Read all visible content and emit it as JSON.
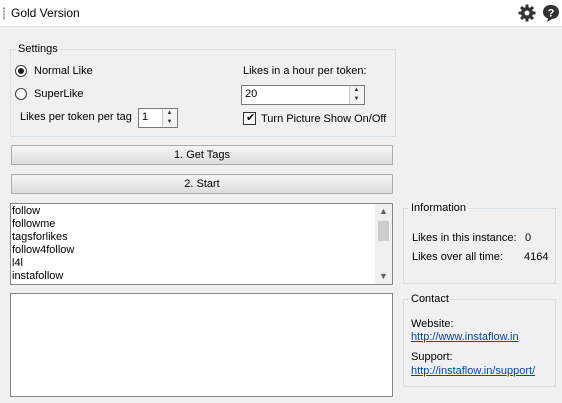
{
  "window": {
    "title": "Gold Version"
  },
  "icons": {
    "settings": "gear-icon",
    "help": "help-bubble-icon"
  },
  "settings": {
    "legend": "Settings",
    "normal_like": {
      "label": "Normal Like",
      "selected": true
    },
    "super_like": {
      "label": "SuperLike",
      "selected": false
    },
    "likes_per_token_per_tag": {
      "label": "Likes per token per tag",
      "value": "1"
    },
    "likes_in_hour": {
      "label": "Likes in a hour per token:",
      "value": "20"
    },
    "picture_show": {
      "label": "Turn Picture Show On/Off",
      "checked": true
    }
  },
  "buttons": {
    "get_tags": "1. Get Tags",
    "start": "2. Start"
  },
  "tags": [
    "follow",
    "followme",
    "tagsforlikes",
    "follow4follow",
    "l4l",
    "instafollow",
    "l4l"
  ],
  "log_text": "",
  "information": {
    "legend": "Information",
    "instance_label": "Likes in this instance:",
    "instance_value": "0",
    "overall_label": "Likes over all time:",
    "overall_value": "4164"
  },
  "contact": {
    "legend": "Contact",
    "website_label": "Website:",
    "website_link": "http://www.instaflow.in",
    "support_label": "Support:",
    "support_link": "http://instaflow.in/support/"
  },
  "colors": {
    "link": "#0645ad",
    "background": "#f0f0f0",
    "group_border": "#d5dfe5"
  }
}
